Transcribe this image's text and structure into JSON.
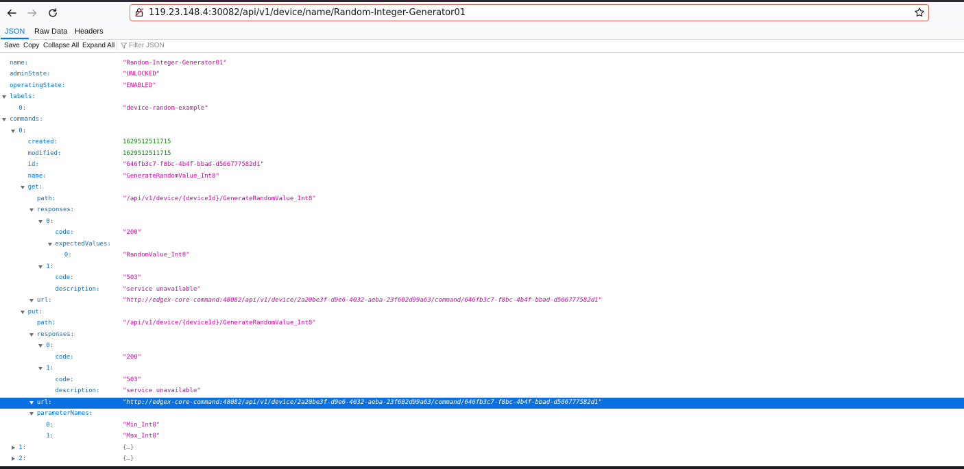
{
  "browser": {
    "url": "119.23.148.4:30082/api/v1/device/name/Random-Integer-Generator01"
  },
  "tabs": [
    {
      "label": "JSON"
    },
    {
      "label": "Raw Data"
    },
    {
      "label": "Headers"
    }
  ],
  "toolbar": {
    "save": "Save",
    "copy": "Copy",
    "collapse_all": "Collapse All",
    "expand_all": "Expand All",
    "filter_placeholder": "Filter JSON"
  },
  "tree": [
    {
      "key": "id:",
      "value": "\"…\"",
      "type": "string",
      "depth": 0,
      "twisty": "none"
    },
    {
      "key": "name:",
      "value": "\"Random-Integer-Generator01\"",
      "type": "string",
      "depth": 0,
      "twisty": "none"
    },
    {
      "key": "adminState:",
      "value": "\"UNLOCKED\"",
      "type": "string",
      "depth": 0,
      "twisty": "none"
    },
    {
      "key": "operatingState:",
      "value": "\"ENABLED\"",
      "type": "string",
      "depth": 0,
      "twisty": "none"
    },
    {
      "key": "labels:",
      "value": "",
      "type": "none",
      "depth": 0,
      "twisty": "open"
    },
    {
      "key": "0:",
      "value": "\"device-random-example\"",
      "type": "string",
      "depth": 1,
      "twisty": "none"
    },
    {
      "key": "commands:",
      "value": "",
      "type": "none",
      "depth": 0,
      "twisty": "open"
    },
    {
      "key": "0:",
      "value": "",
      "type": "none",
      "depth": 1,
      "twisty": "open"
    },
    {
      "key": "created:",
      "value": "1629512511715",
      "type": "number",
      "depth": 2,
      "twisty": "none"
    },
    {
      "key": "modified:",
      "value": "1629512511715",
      "type": "number",
      "depth": 2,
      "twisty": "none"
    },
    {
      "key": "id:",
      "value": "\"646fb3c7-f8bc-4b4f-bbad-d566777582d1\"",
      "type": "string",
      "depth": 2,
      "twisty": "none"
    },
    {
      "key": "name:",
      "value": "\"GenerateRandomValue_Int8\"",
      "type": "string",
      "depth": 2,
      "twisty": "none"
    },
    {
      "key": "get:",
      "value": "",
      "type": "none",
      "depth": 2,
      "twisty": "open"
    },
    {
      "key": "path:",
      "value": "\"/api/v1/device/{deviceId}/GenerateRandomValue_Int8\"",
      "type": "string",
      "depth": 3,
      "twisty": "none"
    },
    {
      "key": "responses:",
      "value": "",
      "type": "none",
      "depth": 3,
      "twisty": "open"
    },
    {
      "key": "0:",
      "value": "",
      "type": "none",
      "depth": 4,
      "twisty": "open"
    },
    {
      "key": "code:",
      "value": "\"200\"",
      "type": "string",
      "depth": 5,
      "twisty": "none"
    },
    {
      "key": "expectedValues:",
      "value": "",
      "type": "none",
      "depth": 5,
      "twisty": "open"
    },
    {
      "key": "0:",
      "value": "\"RandomValue_Int8\"",
      "type": "string",
      "depth": 6,
      "twisty": "none"
    },
    {
      "key": "1:",
      "value": "",
      "type": "none",
      "depth": 4,
      "twisty": "open"
    },
    {
      "key": "code:",
      "value": "\"503\"",
      "type": "string",
      "depth": 5,
      "twisty": "none"
    },
    {
      "key": "description:",
      "value": "\"service unavailable\"",
      "type": "string",
      "depth": 5,
      "twisty": "none"
    },
    {
      "key": "url:",
      "value": "\"http://edgex-core-command:48082/api/v1/device/2a20be3f-d9e6-4032-aeba-23f602d99a63/command/646fb3c7-f8bc-4b4f-bbad-d566777582d1\"",
      "type": "url",
      "depth": 3,
      "twisty": "open"
    },
    {
      "key": "put:",
      "value": "",
      "type": "none",
      "depth": 2,
      "twisty": "open"
    },
    {
      "key": "path:",
      "value": "\"/api/v1/device/{deviceId}/GenerateRandomValue_Int8\"",
      "type": "string",
      "depth": 3,
      "twisty": "none"
    },
    {
      "key": "responses:",
      "value": "",
      "type": "none",
      "depth": 3,
      "twisty": "open"
    },
    {
      "key": "0:",
      "value": "",
      "type": "none",
      "depth": 4,
      "twisty": "open"
    },
    {
      "key": "code:",
      "value": "\"200\"",
      "type": "string",
      "depth": 5,
      "twisty": "none"
    },
    {
      "key": "1:",
      "value": "",
      "type": "none",
      "depth": 4,
      "twisty": "open"
    },
    {
      "key": "code:",
      "value": "\"503\"",
      "type": "string",
      "depth": 5,
      "twisty": "none"
    },
    {
      "key": "description:",
      "value": "\"service unavailable\"",
      "type": "string",
      "depth": 5,
      "twisty": "none"
    },
    {
      "key": "url:",
      "value": "\"http://edgex-core-command:48082/api/v1/device/2a20be3f-d9e6-4032-aeba-23f602d99a63/command/646fb3c7-f8bc-4b4f-bbad-d566777582d1\"",
      "type": "url",
      "depth": 3,
      "twisty": "open",
      "selected": true
    },
    {
      "key": "parameterNames:",
      "value": "",
      "type": "none",
      "depth": 3,
      "twisty": "open"
    },
    {
      "key": "0:",
      "value": "\"Min_Int8\"",
      "type": "string",
      "depth": 4,
      "twisty": "none"
    },
    {
      "key": "1:",
      "value": "\"Max_Int8\"",
      "type": "string",
      "depth": 4,
      "twisty": "none"
    },
    {
      "key": "1:",
      "value": "{…}",
      "type": "summary",
      "depth": 1,
      "twisty": "collapsed"
    },
    {
      "key": "2:",
      "value": "{…}",
      "type": "summary",
      "depth": 1,
      "twisty": "collapsed"
    }
  ]
}
